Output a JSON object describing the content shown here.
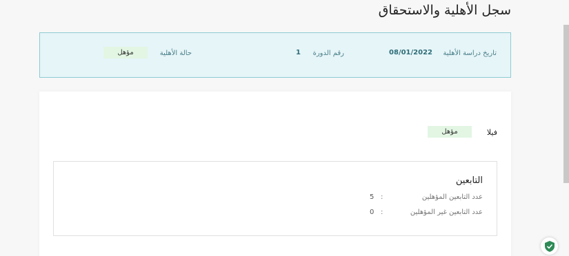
{
  "page": {
    "title": "سجل الأهلية والاستحقاق"
  },
  "summary": {
    "eligibility_date_label": "تاريخ دراسة الأهلية",
    "eligibility_date_value": "08/01/2022",
    "cycle_label": "رقم الدورة",
    "cycle_value": "1",
    "status_label": "حالة الأهلية",
    "status_value": "مؤهل"
  },
  "property": {
    "type": "فيلا",
    "status": "مؤهل"
  },
  "dependents": {
    "title": "التابعين",
    "rows": [
      {
        "label": "عدد التابعين المؤهلين",
        "colon": ":",
        "value": "5"
      },
      {
        "label": "عدد التابعين غير المؤهلين",
        "colon": ":",
        "value": "0"
      }
    ]
  },
  "colors": {
    "accent": "#8dcbd3",
    "summary_bg": "#e6f5f8",
    "eligible_badge_bg": "#e2f6e3",
    "shield": "#2e8b57"
  },
  "icons": {
    "floating": "shield-check-icon"
  }
}
